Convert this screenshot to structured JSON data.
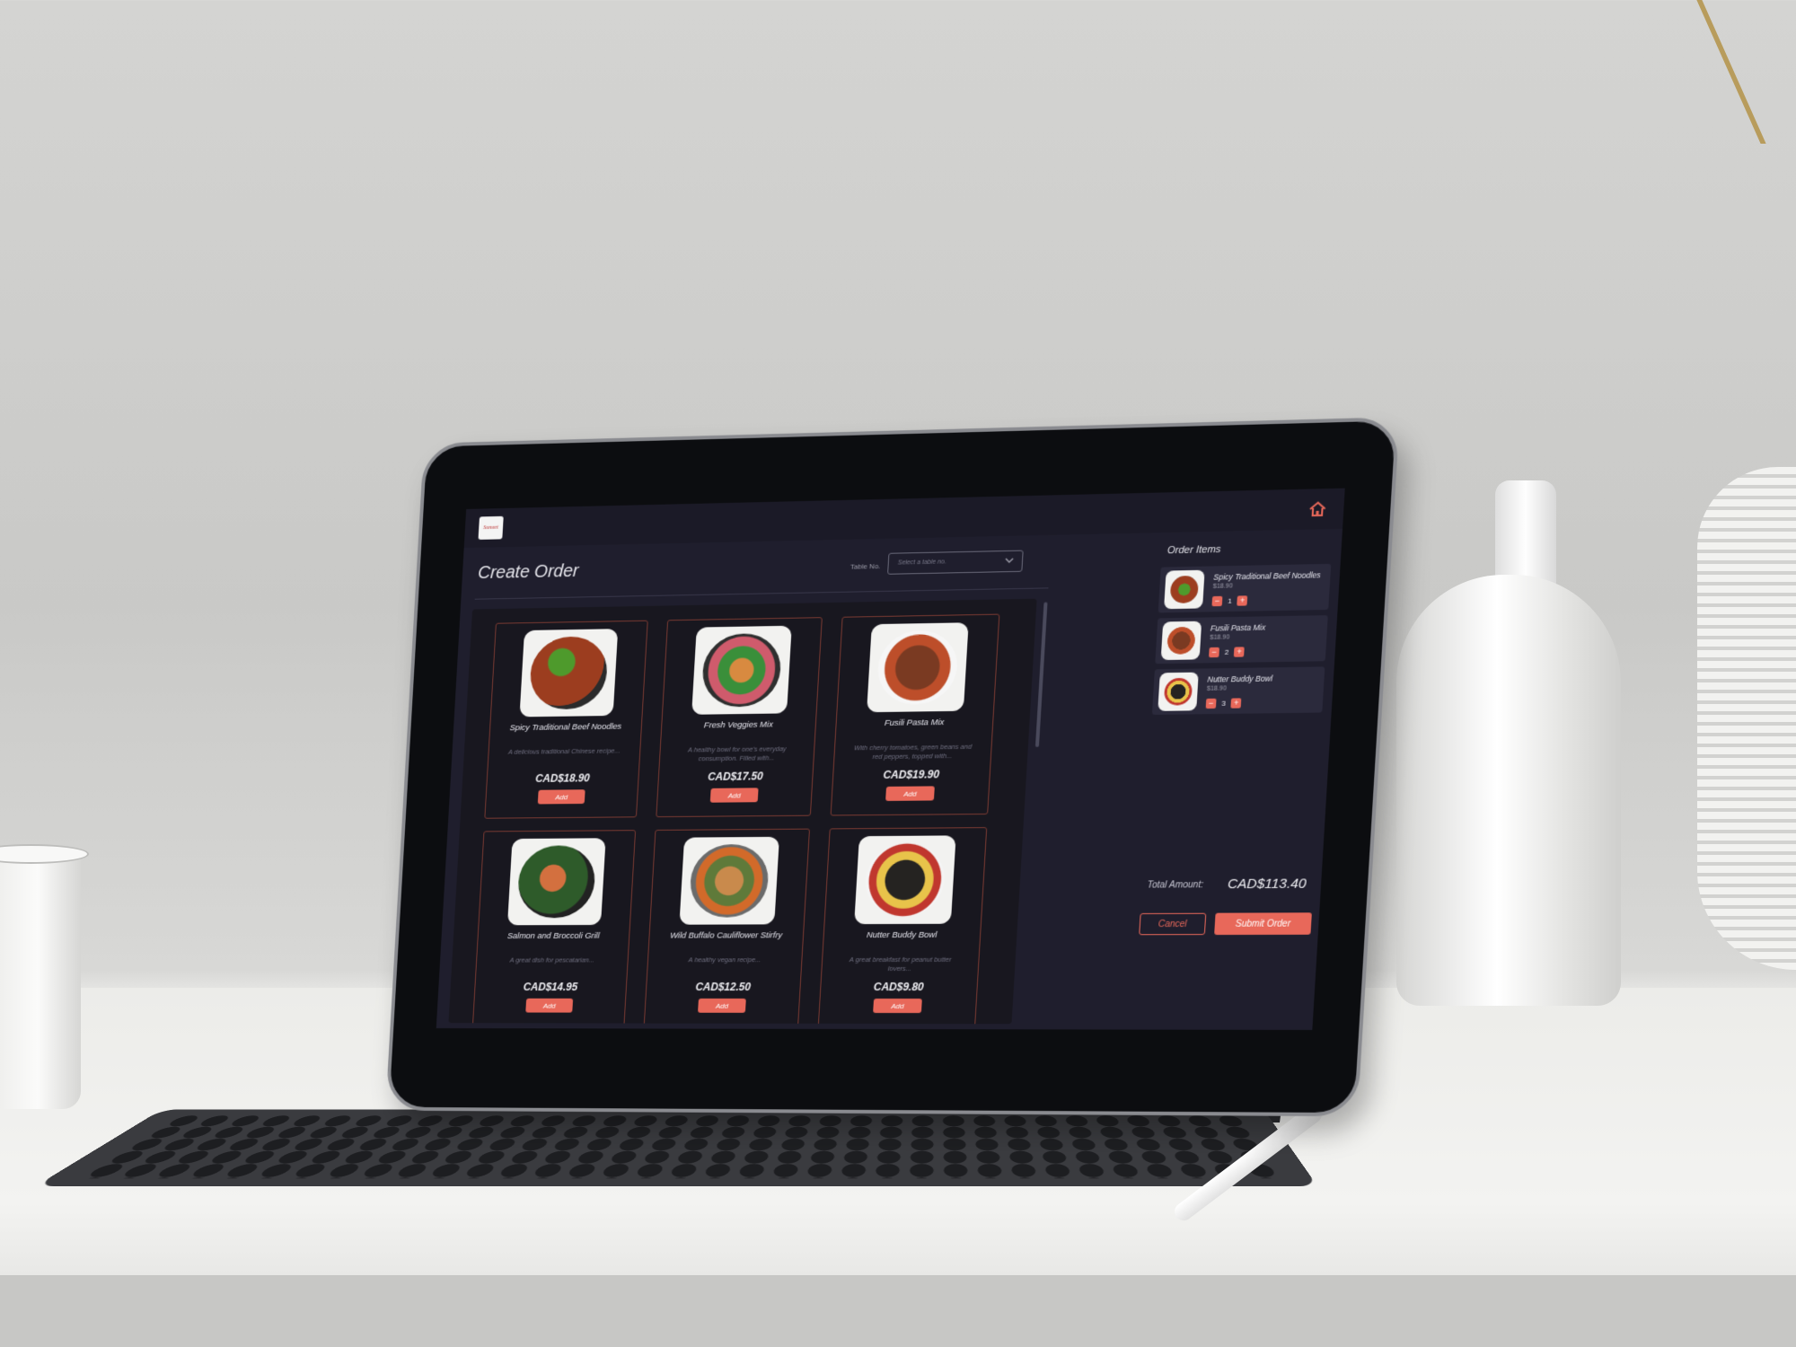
{
  "app": {
    "logo_text": "Sumeet"
  },
  "header": {
    "title": "Create Order",
    "table_label": "Table No.",
    "table_placeholder": "Select a table no."
  },
  "menu": [
    {
      "name": "Spicy Traditional Beef Noodles",
      "desc": "A delicious traditional Chinese recipe...",
      "price": "CAD$18.90",
      "add": "Add"
    },
    {
      "name": "Fresh Veggies Mix",
      "desc": "A healthy bowl for one's everyday consumption. Filled with...",
      "price": "CAD$17.50",
      "add": "Add"
    },
    {
      "name": "Fusili Pasta Mix",
      "desc": "With cherry tomatoes, green beans and red peppers, topped with...",
      "price": "CAD$19.90",
      "add": "Add"
    },
    {
      "name": "Salmon and Broccoli Grill",
      "desc": "A great dish for pescatarian...",
      "price": "CAD$14.95",
      "add": "Add"
    },
    {
      "name": "Wild Buffalo Cauliflower Stirfry",
      "desc": "A healthy vegan recipe...",
      "price": "CAD$12.50",
      "add": "Add"
    },
    {
      "name": "Nutter Buddy Bowl",
      "desc": "A great breakfast for peanut butter lovers...",
      "price": "CAD$9.80",
      "add": "Add"
    }
  ],
  "order": {
    "title": "Order Items",
    "items": [
      {
        "name": "Spicy Traditional Beef Noodles",
        "price": "$18.90",
        "qty": "1"
      },
      {
        "name": "Fusili Pasta Mix",
        "price": "$18.90",
        "qty": "2"
      },
      {
        "name": "Nutter Buddy Bowl",
        "price": "$18.90",
        "qty": "3"
      }
    ],
    "qty_minus": "−",
    "qty_plus": "+",
    "total_label": "Total Amount:",
    "total_value": "CAD$113.40",
    "cancel": "Cancel",
    "submit": "Submit Order"
  },
  "colors": {
    "accent": "#e8685a",
    "screen_bg": "#1f1e2d",
    "panel_bg": "#18171f"
  },
  "icons": {
    "home": "home-icon",
    "dropdown": "chevron-down-icon"
  }
}
